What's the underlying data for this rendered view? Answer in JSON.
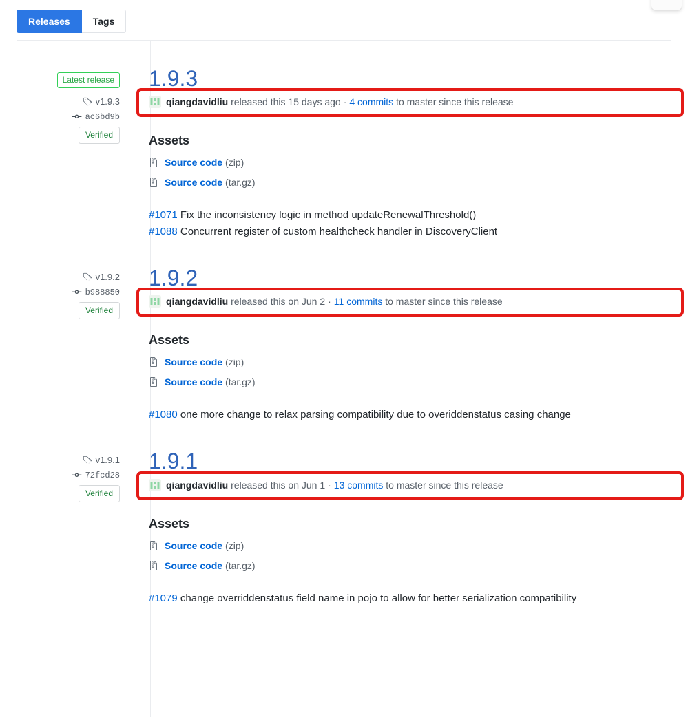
{
  "tabs": [
    {
      "label": "Releases",
      "selected": true
    },
    {
      "label": "Tags",
      "selected": false
    }
  ],
  "colors": {
    "accent_blue": "#0366d6",
    "tab_active_bg": "#2b77e4",
    "title_link": "#2f63b8",
    "highlight_red": "#e41b17",
    "latest_green": "#28a745",
    "verified_green": "#1a7f37",
    "avatar_green": "#8ed6a4"
  },
  "releases": [
    {
      "latest_badge": "Latest release",
      "tag": "v1.9.3",
      "tag_icon": "tag-icon",
      "commit": "ac6bd9b",
      "commit_icon": "commit-icon",
      "verified": "Verified",
      "title": "1.9.3",
      "byline": {
        "avatar_icon": "avatar-identicon",
        "author": "qiangdavidliu",
        "released_text": "released this",
        "date": "15 days ago",
        "separator": "·",
        "commits_link": "4 commits",
        "suffix": "to master since this release"
      },
      "assets_heading": "Assets",
      "assets": [
        {
          "icon": "file-zip-icon",
          "name": "Source code",
          "ext": "(zip)"
        },
        {
          "icon": "file-zip-icon",
          "name": "Source code",
          "ext": "(tar.gz)"
        }
      ],
      "notes": [
        {
          "ref": "#1071",
          "text": "Fix the inconsistency logic in method updateRenewalThreshold()"
        },
        {
          "ref": "#1088",
          "text": "Concurrent register of custom healthcheck handler in DiscoveryClient"
        }
      ]
    },
    {
      "latest_badge": "",
      "tag": "v1.9.2",
      "tag_icon": "tag-icon",
      "commit": "b988850",
      "commit_icon": "commit-icon",
      "verified": "Verified",
      "title": "1.9.2",
      "byline": {
        "avatar_icon": "avatar-identicon",
        "author": "qiangdavidliu",
        "released_text": "released this",
        "date": "on Jun 2",
        "separator": "·",
        "commits_link": "11 commits",
        "suffix": "to master since this release"
      },
      "assets_heading": "Assets",
      "assets": [
        {
          "icon": "file-zip-icon",
          "name": "Source code",
          "ext": "(zip)"
        },
        {
          "icon": "file-zip-icon",
          "name": "Source code",
          "ext": "(tar.gz)"
        }
      ],
      "notes": [
        {
          "ref": "#1080",
          "text": "one more change to relax parsing compatibility due to overiddenstatus casing change"
        }
      ]
    },
    {
      "latest_badge": "",
      "tag": "v1.9.1",
      "tag_icon": "tag-icon",
      "commit": "72fcd28",
      "commit_icon": "commit-icon",
      "verified": "Verified",
      "title": "1.9.1",
      "byline": {
        "avatar_icon": "avatar-identicon",
        "author": "qiangdavidliu",
        "released_text": "released this",
        "date": "on Jun 1",
        "separator": "·",
        "commits_link": "13 commits",
        "suffix": "to master since this release"
      },
      "assets_heading": "Assets",
      "assets": [
        {
          "icon": "file-zip-icon",
          "name": "Source code",
          "ext": "(zip)"
        },
        {
          "icon": "file-zip-icon",
          "name": "Source code",
          "ext": "(tar.gz)"
        }
      ],
      "notes": [
        {
          "ref": "#1079",
          "text": "change overriddenstatus field name in pojo to allow for better serialization compatibility"
        }
      ]
    }
  ]
}
